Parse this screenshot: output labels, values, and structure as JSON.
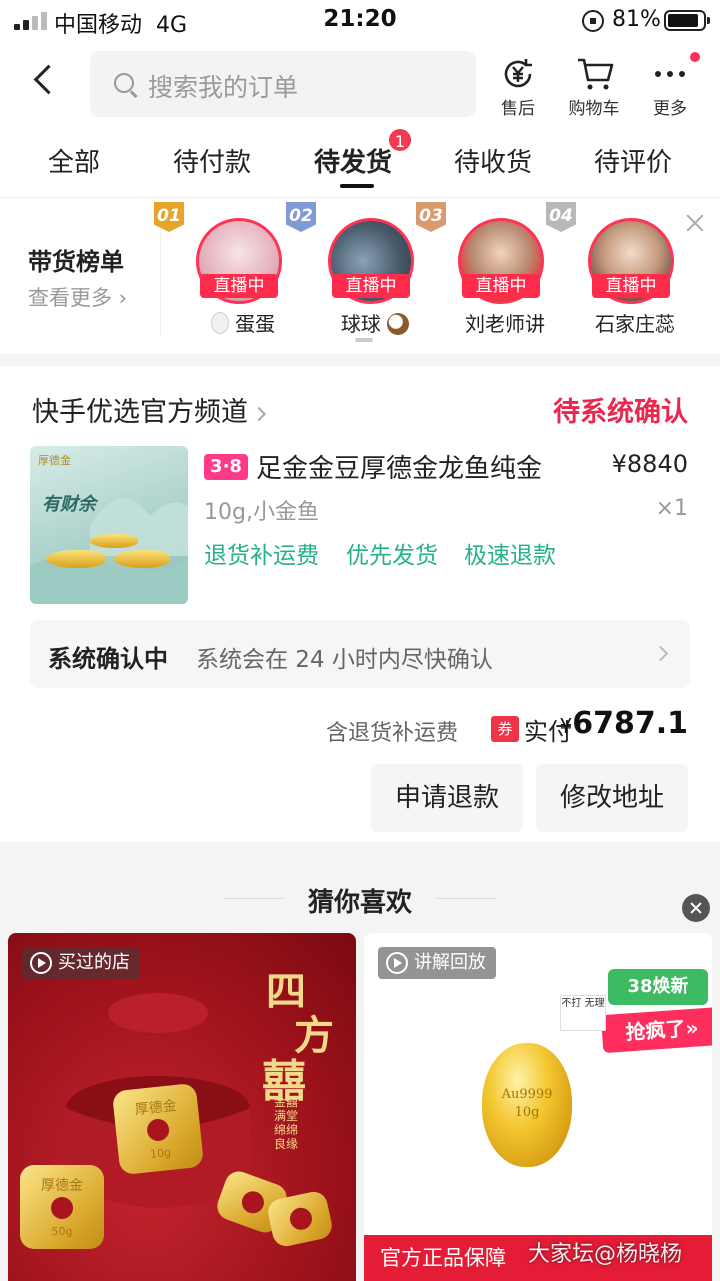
{
  "status_bar": {
    "carrier": "中国移动",
    "network": "4G",
    "time": "21:20",
    "battery": "81%"
  },
  "header": {
    "search_placeholder": "搜索我的订单",
    "actions": [
      {
        "label": "售后",
        "icon": "after-sale-yuan-icon"
      },
      {
        "label": "购物车",
        "icon": "cart-icon"
      },
      {
        "label": "更多",
        "icon": "more-dots-icon"
      }
    ]
  },
  "tabs": {
    "items": [
      "全部",
      "待付款",
      "待发货",
      "待收货",
      "待评价"
    ],
    "active_index": 2,
    "badge": "1"
  },
  "ranking": {
    "title": "带货榜单",
    "more": "查看更多",
    "live_label": "直播中",
    "streamers": [
      {
        "rank": "01",
        "name": "蛋蛋",
        "name_icon": "egg-emoji"
      },
      {
        "rank": "02",
        "name": "球球",
        "name_icon": "coconut-emoji"
      },
      {
        "rank": "03",
        "name": "刘老师讲",
        "name_icon": ""
      },
      {
        "rank": "04",
        "name": "石家庄蕊",
        "name_icon": ""
      }
    ]
  },
  "order": {
    "shop": "快手优选官方频道",
    "status": "待系统确认",
    "product": {
      "tag": "3·8",
      "title": "足金金豆厚德金龙鱼纯金",
      "price": "¥8840",
      "spec": "10g,小金鱼",
      "qty": "×1",
      "services": [
        "退货补运费",
        "优先发货",
        "极速退款"
      ],
      "thumb_brand": "厚德金",
      "thumb_title": "有财余"
    },
    "confirm": {
      "title": "系统确认中",
      "desc": "系统会在 24 小时内尽快确认"
    },
    "total": {
      "note": "含退货补运费",
      "coupon_tag": "券",
      "label": "实付",
      "currency": "¥",
      "amount": "6787.1"
    },
    "buttons": [
      "申请退款",
      "修改地址"
    ]
  },
  "recommend": {
    "title": "猜你喜欢",
    "cards": [
      {
        "badge": "买过的店",
        "vertical_title": [
          "四",
          "方",
          "囍"
        ],
        "sub_text": "金囍满堂 绵绵良缘",
        "coin_text": "厚德金",
        "coin_weight": "10g",
        "coin_weight_small": "50g"
      },
      {
        "badge": "讲解回放",
        "promo_top": "38焕新",
        "promo_ribbon": "抢疯了»",
        "promo_small": "不打 无理",
        "oval_text": [
          "Au9999",
          "10g"
        ],
        "bottom": "官方正品保障"
      }
    ]
  },
  "watermark": "大家坛@杨晓杨",
  "colors": {
    "accent_red": "#e8284e",
    "service_green": "#27b089",
    "live_red": "#ff2b4a"
  }
}
